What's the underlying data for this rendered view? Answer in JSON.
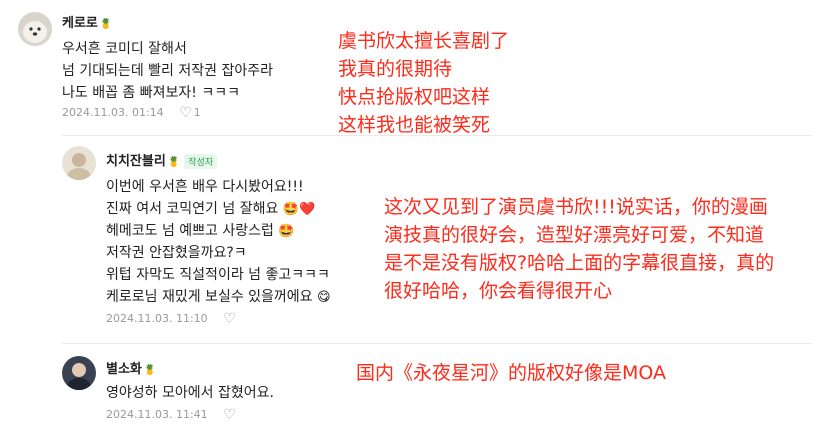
{
  "comments": [
    {
      "nickname": "케로로",
      "lines": [
        "우서흔 코미디 잘해서",
        "넘 기대되는데 빨리 저작권 잡아주라",
        "나도 배꼽 좀 빠져보자! ㅋㅋㅋ"
      ],
      "date": "2024.11.03. 01:14",
      "likes": "1",
      "translation": [
        "虞书欣太擅长喜剧了",
        "我真的很期待",
        "快点抢版权吧这样",
        "这样我也能被笑死"
      ]
    },
    {
      "nickname": "치치잔블리",
      "author_badge": "작성자",
      "lines": [
        "이번에 우서흔 배우 다시봤어요!!!",
        "진짜 여서 코믹연기 넘 잘해요",
        "헤메코도 넘 예쁘고 사랑스럽",
        "저작권 안잡혔을까요?ㅋ",
        "위텁 자막도 직설적이라 넘 좋고ㅋㅋㅋ",
        "케로로님 재밌게 보실수 있을꺼에요"
      ],
      "date": "2024.11.03. 11:10",
      "translation": [
        "这次又见到了演员虞书欣!!!说实话，你的漫画",
        "演技真的很好会，造型好漂亮好可爱，不知道",
        "是不是没有版权?哈哈上面的字幕很直接，真的",
        "很好哈哈，你会看得很开心"
      ]
    },
    {
      "nickname": "별소화",
      "lines": [
        "영야성하 모아에서 잡혔어요."
      ],
      "date": "2024.11.03. 11:41",
      "translation": [
        "国内《永夜星河》的版权好像是MOA"
      ]
    }
  ],
  "icons": {
    "like": "heart-outline-icon",
    "pineapple": "pineapple-icon"
  },
  "colors": {
    "annotation": "#ff2a1a",
    "meta": "#999999",
    "badge": "#2aa34a"
  }
}
